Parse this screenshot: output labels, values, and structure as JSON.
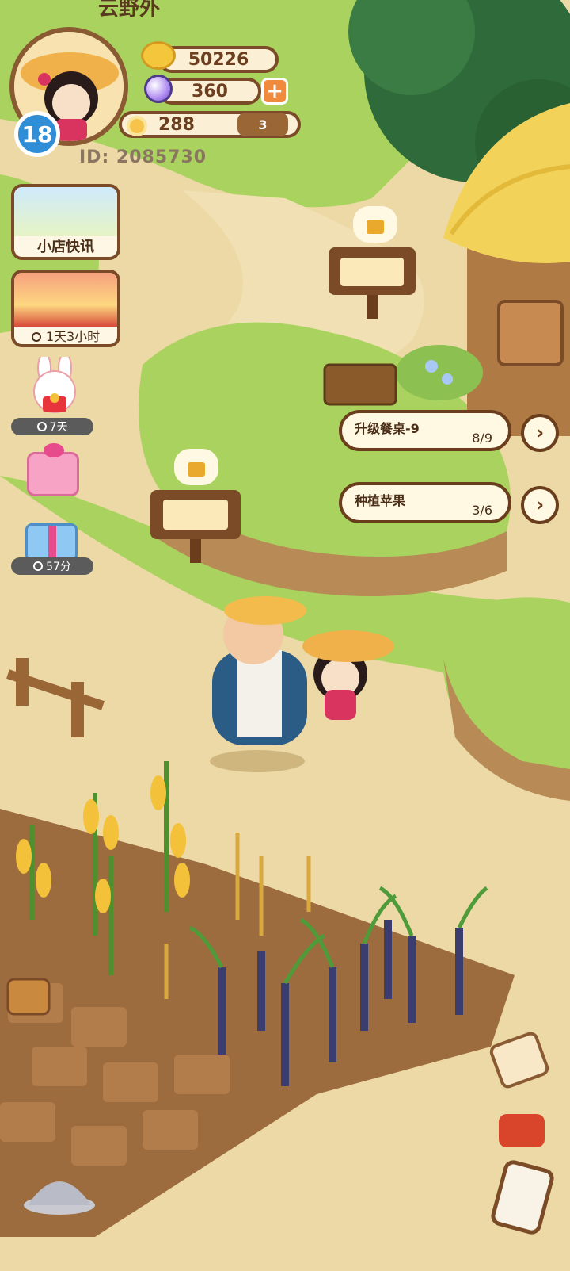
{
  "top_title": "云野外",
  "player": {
    "level": "18",
    "id_text": "ID: 2085730"
  },
  "resources": {
    "coins": "50226",
    "gems": "360",
    "flowers": "288",
    "badge": "3"
  },
  "side_menu": {
    "shop_news": "小店快讯",
    "event_timer": "1天3小时",
    "bunny_timer": "7天",
    "gift_timer": "57分"
  },
  "quests": [
    {
      "title": "升级餐桌-9",
      "progress": "8/9"
    },
    {
      "title": "种植苹果",
      "progress": "3/6"
    }
  ],
  "colors": {
    "accent_blue": "#2f8ed6",
    "brown": "#7b4a26",
    "grass": "#9fcf55",
    "path": "#ecd9a6"
  }
}
